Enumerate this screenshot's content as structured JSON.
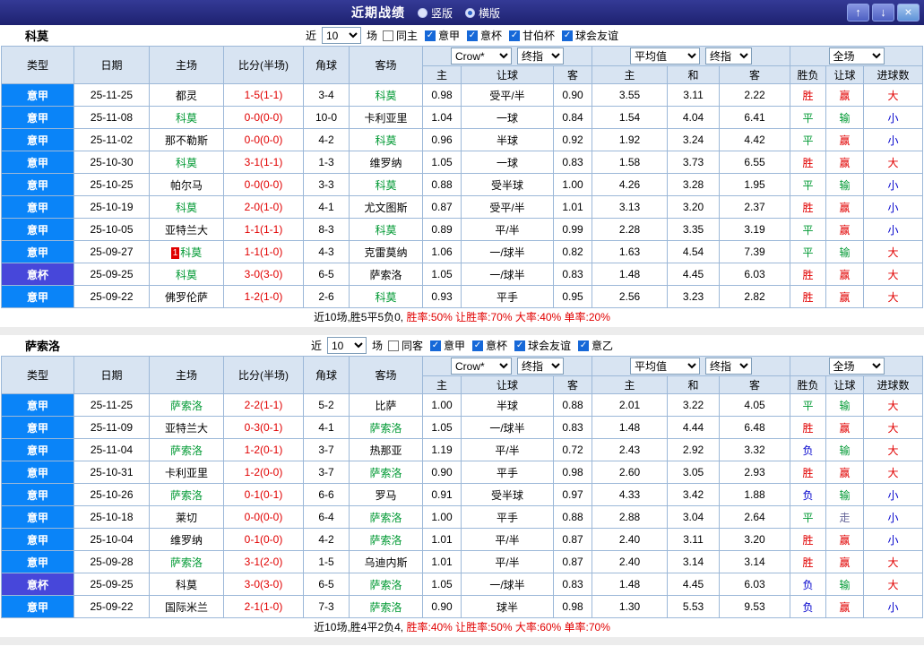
{
  "titlebar": {
    "title": "近期战绩",
    "radios": [
      {
        "label": "竖版",
        "selected": false
      },
      {
        "label": "横版",
        "selected": true
      }
    ],
    "buttons": {
      "up": "↑",
      "down": "↓",
      "close": "×"
    }
  },
  "table_header": {
    "static_cols": [
      "类型",
      "日期",
      "主场",
      "比分(半场)",
      "角球",
      "客场"
    ],
    "asia_select1": "Crow*",
    "asia_select2": "终指",
    "asia_cols": [
      "主",
      "让球",
      "客"
    ],
    "euro_select1": "平均值",
    "euro_select2": "终指",
    "euro_cols": [
      "主",
      "和",
      "客"
    ],
    "scope_select": "全场",
    "result_cols": [
      "胜负",
      "让球",
      "进球数"
    ]
  },
  "palette": {
    "league_serie_a": "#0a84f8",
    "league_cup": "#4747da",
    "win": "#e10000",
    "draw": "#009933",
    "lose": "#0000cc",
    "push": "#666699",
    "score": "#e10000",
    "focus_team": "#009933"
  },
  "sections": [
    {
      "team": "科莫",
      "filter": {
        "prefix": "近",
        "count": "10",
        "suffix": "场",
        "options": [
          {
            "label": "同主",
            "checked": false
          },
          {
            "label": "意甲",
            "checked": true
          },
          {
            "label": "意杯",
            "checked": true
          },
          {
            "label": "甘伯杯",
            "checked": true
          },
          {
            "label": "球会友谊",
            "checked": true
          }
        ]
      },
      "rows": [
        {
          "league": "意甲",
          "date": "25-11-25",
          "home": "都灵",
          "home_focus": false,
          "score": "1-5(1-1)",
          "corners": "3-4",
          "away": "科莫",
          "away_focus": true,
          "asia_home": "0.98",
          "asia_handicap": "受平/半",
          "asia_away": "0.90",
          "euro_home": "3.55",
          "euro_draw": "3.11",
          "euro_away": "2.22",
          "result": "胜",
          "handicap_result": "赢",
          "goals": "大"
        },
        {
          "league": "意甲",
          "date": "25-11-08",
          "home": "科莫",
          "home_focus": true,
          "score": "0-0(0-0)",
          "corners": "10-0",
          "away": "卡利亚里",
          "away_focus": false,
          "asia_home": "1.04",
          "asia_handicap": "一球",
          "asia_away": "0.84",
          "euro_home": "1.54",
          "euro_draw": "4.04",
          "euro_away": "6.41",
          "result": "平",
          "handicap_result": "输",
          "goals": "小"
        },
        {
          "league": "意甲",
          "date": "25-11-02",
          "home": "那不勒斯",
          "home_focus": false,
          "score": "0-0(0-0)",
          "corners": "4-2",
          "away": "科莫",
          "away_focus": true,
          "asia_home": "0.96",
          "asia_handicap": "半球",
          "asia_away": "0.92",
          "euro_home": "1.92",
          "euro_draw": "3.24",
          "euro_away": "4.42",
          "result": "平",
          "handicap_result": "赢",
          "goals": "小"
        },
        {
          "league": "意甲",
          "date": "25-10-30",
          "home": "科莫",
          "home_focus": true,
          "score": "3-1(1-1)",
          "corners": "1-3",
          "away": "维罗纳",
          "away_focus": false,
          "asia_home": "1.05",
          "asia_handicap": "一球",
          "asia_away": "0.83",
          "euro_home": "1.58",
          "euro_draw": "3.73",
          "euro_away": "6.55",
          "result": "胜",
          "handicap_result": "赢",
          "goals": "大"
        },
        {
          "league": "意甲",
          "date": "25-10-25",
          "home": "帕尔马",
          "home_focus": false,
          "score": "0-0(0-0)",
          "corners": "3-3",
          "away": "科莫",
          "away_focus": true,
          "asia_home": "0.88",
          "asia_handicap": "受半球",
          "asia_away": "1.00",
          "euro_home": "4.26",
          "euro_draw": "3.28",
          "euro_away": "1.95",
          "result": "平",
          "handicap_result": "输",
          "goals": "小"
        },
        {
          "league": "意甲",
          "date": "25-10-19",
          "home": "科莫",
          "home_focus": true,
          "score": "2-0(1-0)",
          "corners": "4-1",
          "away": "尤文图斯",
          "away_focus": false,
          "asia_home": "0.87",
          "asia_handicap": "受平/半",
          "asia_away": "1.01",
          "euro_home": "3.13",
          "euro_draw": "3.20",
          "euro_away": "2.37",
          "result": "胜",
          "handicap_result": "赢",
          "goals": "小"
        },
        {
          "league": "意甲",
          "date": "25-10-05",
          "home": "亚特兰大",
          "home_focus": false,
          "score": "1-1(1-1)",
          "corners": "8-3",
          "away": "科莫",
          "away_focus": true,
          "asia_home": "0.89",
          "asia_handicap": "平/半",
          "asia_away": "0.99",
          "euro_home": "2.28",
          "euro_draw": "3.35",
          "euro_away": "3.19",
          "result": "平",
          "handicap_result": "赢",
          "goals": "小"
        },
        {
          "league": "意甲",
          "date": "25-09-27",
          "home": "科莫",
          "home_focus": true,
          "home_badge": "1",
          "score": "1-1(1-0)",
          "corners": "4-3",
          "away": "克雷莫纳",
          "away_focus": false,
          "asia_home": "1.06",
          "asia_handicap": "一/球半",
          "asia_away": "0.82",
          "euro_home": "1.63",
          "euro_draw": "4.54",
          "euro_away": "7.39",
          "result": "平",
          "handicap_result": "输",
          "goals": "大"
        },
        {
          "league": "意杯",
          "date": "25-09-25",
          "home": "科莫",
          "home_focus": true,
          "score": "3-0(3-0)",
          "corners": "6-5",
          "away": "萨索洛",
          "away_focus": false,
          "asia_home": "1.05",
          "asia_handicap": "一/球半",
          "asia_away": "0.83",
          "euro_home": "1.48",
          "euro_draw": "4.45",
          "euro_away": "6.03",
          "result": "胜",
          "handicap_result": "赢",
          "goals": "大"
        },
        {
          "league": "意甲",
          "date": "25-09-22",
          "home": "佛罗伦萨",
          "home_focus": false,
          "score": "1-2(1-0)",
          "corners": "2-6",
          "away": "科莫",
          "away_focus": true,
          "asia_home": "0.93",
          "asia_handicap": "平手",
          "asia_away": "0.95",
          "euro_home": "2.56",
          "euro_draw": "3.23",
          "euro_away": "2.82",
          "result": "胜",
          "handicap_result": "赢",
          "goals": "大"
        }
      ],
      "summary": {
        "record": "近10场,胜5平5负0,",
        "stats": "胜率:50% 让胜率:70% 大率:40% 单率:20%"
      }
    },
    {
      "team": "萨索洛",
      "filter": {
        "prefix": "近",
        "count": "10",
        "suffix": "场",
        "options": [
          {
            "label": "同客",
            "checked": false
          },
          {
            "label": "意甲",
            "checked": true
          },
          {
            "label": "意杯",
            "checked": true
          },
          {
            "label": "球会友谊",
            "checked": true
          },
          {
            "label": "意乙",
            "checked": true
          }
        ]
      },
      "rows": [
        {
          "league": "意甲",
          "date": "25-11-25",
          "home": "萨索洛",
          "home_focus": true,
          "score": "2-2(1-1)",
          "corners": "5-2",
          "away": "比萨",
          "away_focus": false,
          "asia_home": "1.00",
          "asia_handicap": "半球",
          "asia_away": "0.88",
          "euro_home": "2.01",
          "euro_draw": "3.22",
          "euro_away": "4.05",
          "result": "平",
          "handicap_result": "输",
          "goals": "大"
        },
        {
          "league": "意甲",
          "date": "25-11-09",
          "home": "亚特兰大",
          "home_focus": false,
          "score": "0-3(0-1)",
          "corners": "4-1",
          "away": "萨索洛",
          "away_focus": true,
          "asia_home": "1.05",
          "asia_handicap": "一/球半",
          "asia_away": "0.83",
          "euro_home": "1.48",
          "euro_draw": "4.44",
          "euro_away": "6.48",
          "result": "胜",
          "handicap_result": "赢",
          "goals": "大"
        },
        {
          "league": "意甲",
          "date": "25-11-04",
          "home": "萨索洛",
          "home_focus": true,
          "score": "1-2(0-1)",
          "corners": "3-7",
          "away": "热那亚",
          "away_focus": false,
          "asia_home": "1.19",
          "asia_handicap": "平/半",
          "asia_away": "0.72",
          "euro_home": "2.43",
          "euro_draw": "2.92",
          "euro_away": "3.32",
          "result": "负",
          "handicap_result": "输",
          "goals": "大"
        },
        {
          "league": "意甲",
          "date": "25-10-31",
          "home": "卡利亚里",
          "home_focus": false,
          "score": "1-2(0-0)",
          "corners": "3-7",
          "away": "萨索洛",
          "away_focus": true,
          "asia_home": "0.90",
          "asia_handicap": "平手",
          "asia_away": "0.98",
          "euro_home": "2.60",
          "euro_draw": "3.05",
          "euro_away": "2.93",
          "result": "胜",
          "handicap_result": "赢",
          "goals": "大"
        },
        {
          "league": "意甲",
          "date": "25-10-26",
          "home": "萨索洛",
          "home_focus": true,
          "score": "0-1(0-1)",
          "corners": "6-6",
          "away": "罗马",
          "away_focus": false,
          "asia_home": "0.91",
          "asia_handicap": "受半球",
          "asia_away": "0.97",
          "euro_home": "4.33",
          "euro_draw": "3.42",
          "euro_away": "1.88",
          "result": "负",
          "handicap_result": "输",
          "goals": "小"
        },
        {
          "league": "意甲",
          "date": "25-10-18",
          "home": "莱切",
          "home_focus": false,
          "score": "0-0(0-0)",
          "corners": "6-4",
          "away": "萨索洛",
          "away_focus": true,
          "asia_home": "1.00",
          "asia_handicap": "平手",
          "asia_away": "0.88",
          "euro_home": "2.88",
          "euro_draw": "3.04",
          "euro_away": "2.64",
          "result": "平",
          "handicap_result": "走",
          "goals": "小"
        },
        {
          "league": "意甲",
          "date": "25-10-04",
          "home": "维罗纳",
          "home_focus": false,
          "score": "0-1(0-0)",
          "corners": "4-2",
          "away": "萨索洛",
          "away_focus": true,
          "asia_home": "1.01",
          "asia_handicap": "平/半",
          "asia_away": "0.87",
          "euro_home": "2.40",
          "euro_draw": "3.11",
          "euro_away": "3.20",
          "result": "胜",
          "handicap_result": "赢",
          "goals": "小"
        },
        {
          "league": "意甲",
          "date": "25-09-28",
          "home": "萨索洛",
          "home_focus": true,
          "score": "3-1(2-0)",
          "corners": "1-5",
          "away": "乌迪内斯",
          "away_focus": false,
          "asia_home": "1.01",
          "asia_handicap": "平/半",
          "asia_away": "0.87",
          "euro_home": "2.40",
          "euro_draw": "3.14",
          "euro_away": "3.14",
          "result": "胜",
          "handicap_result": "赢",
          "goals": "大"
        },
        {
          "league": "意杯",
          "date": "25-09-25",
          "home": "科莫",
          "home_focus": false,
          "score": "3-0(3-0)",
          "corners": "6-5",
          "away": "萨索洛",
          "away_focus": true,
          "asia_home": "1.05",
          "asia_handicap": "一/球半",
          "asia_away": "0.83",
          "euro_home": "1.48",
          "euro_draw": "4.45",
          "euro_away": "6.03",
          "result": "负",
          "handicap_result": "输",
          "goals": "大"
        },
        {
          "league": "意甲",
          "date": "25-09-22",
          "home": "国际米兰",
          "home_focus": false,
          "score": "2-1(1-0)",
          "corners": "7-3",
          "away": "萨索洛",
          "away_focus": true,
          "asia_home": "0.90",
          "asia_handicap": "球半",
          "asia_away": "0.98",
          "euro_home": "1.30",
          "euro_draw": "5.53",
          "euro_away": "9.53",
          "result": "负",
          "handicap_result": "赢",
          "goals": "小"
        }
      ],
      "summary": {
        "record": "近10场,胜4平2负4,",
        "stats": "胜率:40% 让胜率:50% 大率:60% 单率:70%"
      }
    }
  ]
}
